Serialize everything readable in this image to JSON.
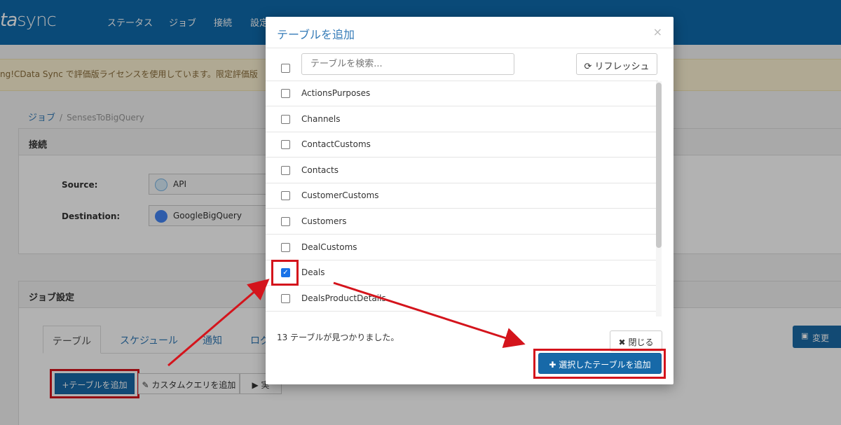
{
  "header": {
    "logo_a": "ta",
    "logo_b": "sync",
    "nav": [
      "ステータス",
      "ジョブ",
      "接続",
      "設定"
    ]
  },
  "notice": {
    "text": "ng!CData Sync で評価版ライセンスを使用しています。限定評価版"
  },
  "breadcrumb": {
    "root": "ジョブ",
    "separator": "/",
    "current": "SensesToBigQuery"
  },
  "connection": {
    "title": "接続",
    "source_label": "Source:",
    "source_value": "API",
    "destination_label": "Destination:",
    "destination_value": "GoogleBigQuery"
  },
  "job_settings": {
    "title": "ジョブ設定",
    "tabs": [
      "テーブル",
      "スケジュール",
      "通知",
      "ログ"
    ],
    "add_table_label": "+テーブルを追加",
    "custom_query_label": "カスタムクエリを追加",
    "run_label": "▶ 実",
    "save_label": "変更"
  },
  "modal": {
    "title": "テーブルを追加",
    "close_symbol": "×",
    "search_placeholder": "テーブルを検索...",
    "refresh_label": "リフレッシュ",
    "tables": [
      {
        "name": "ActionsPurposes",
        "checked": false
      },
      {
        "name": "Channels",
        "checked": false
      },
      {
        "name": "ContactCustoms",
        "checked": false
      },
      {
        "name": "Contacts",
        "checked": false
      },
      {
        "name": "CustomerCustoms",
        "checked": false
      },
      {
        "name": "Customers",
        "checked": false
      },
      {
        "name": "DealCustoms",
        "checked": false
      },
      {
        "name": "Deals",
        "checked": true
      },
      {
        "name": "DealsProductDetails",
        "checked": false
      }
    ],
    "found_text": "13 テーブルが見つかりました。",
    "close_label": "閉じる",
    "add_selected_label": "選択したテーブルを追加"
  },
  "colors": {
    "brand": "#0f6aad",
    "primary": "#1769a8",
    "highlight": "#d4141c"
  }
}
